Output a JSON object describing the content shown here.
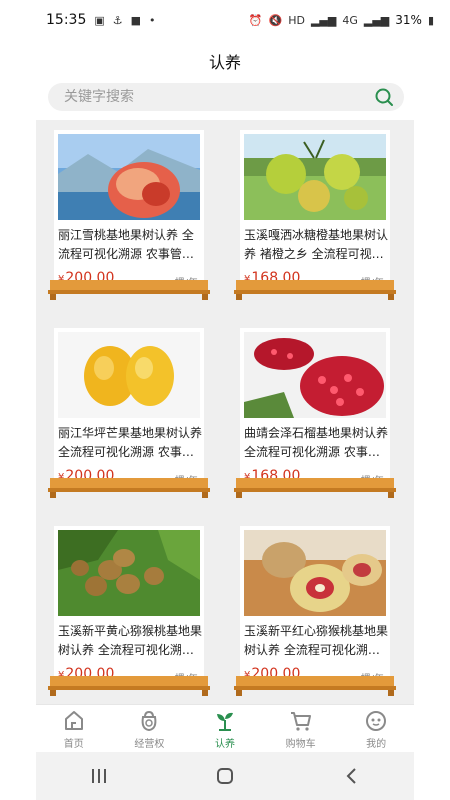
{
  "status_bar": {
    "time": "15:35",
    "battery": "31%",
    "net_label": "HD",
    "signal_label": "4G"
  },
  "page_title": "认养",
  "search": {
    "placeholder": "关键字搜索"
  },
  "products": [
    {
      "title": "丽江雪桃基地果树认养 全流程可视化溯源 农事管…",
      "price": "200.00",
      "currency": "¥",
      "unit": "棵/年",
      "image": "peach"
    },
    {
      "title": "玉溪嘎洒冰糖橙基地果树认养 褚橙之乡 全流程可视…",
      "price": "168.00",
      "currency": "¥",
      "unit": "棵/年",
      "image": "orange"
    },
    {
      "title": "丽江华坪芒果基地果树认养 全流程可视化溯源 农事…",
      "price": "200.00",
      "currency": "¥",
      "unit": "棵/年",
      "image": "mango"
    },
    {
      "title": "曲靖会泽石榴基地果树认养 全流程可视化溯源 农事…",
      "price": "168.00",
      "currency": "¥",
      "unit": "棵/年",
      "image": "pomegranate"
    },
    {
      "title": "玉溪新平黄心猕猴桃基地果树认养 全流程可视化溯…",
      "price": "200.00",
      "currency": "¥",
      "unit": "棵/年",
      "image": "kiwi"
    },
    {
      "title": "玉溪新平红心猕猴桃基地果树认养 全流程可视化溯…",
      "price": "200.00",
      "currency": "¥",
      "unit": "棵/年",
      "image": "red-kiwi"
    }
  ],
  "tabs": [
    {
      "label": "首页",
      "icon": "home-icon",
      "active": false
    },
    {
      "label": "经营权",
      "icon": "bag-icon",
      "active": false
    },
    {
      "label": "认养",
      "icon": "sprout-icon",
      "active": true
    },
    {
      "label": "购物车",
      "icon": "cart-icon",
      "active": false
    },
    {
      "label": "我的",
      "icon": "face-icon",
      "active": false
    }
  ],
  "colors": {
    "accent": "#2a8f4f",
    "price": "#d2331d",
    "shelf": "#e39a3b"
  }
}
